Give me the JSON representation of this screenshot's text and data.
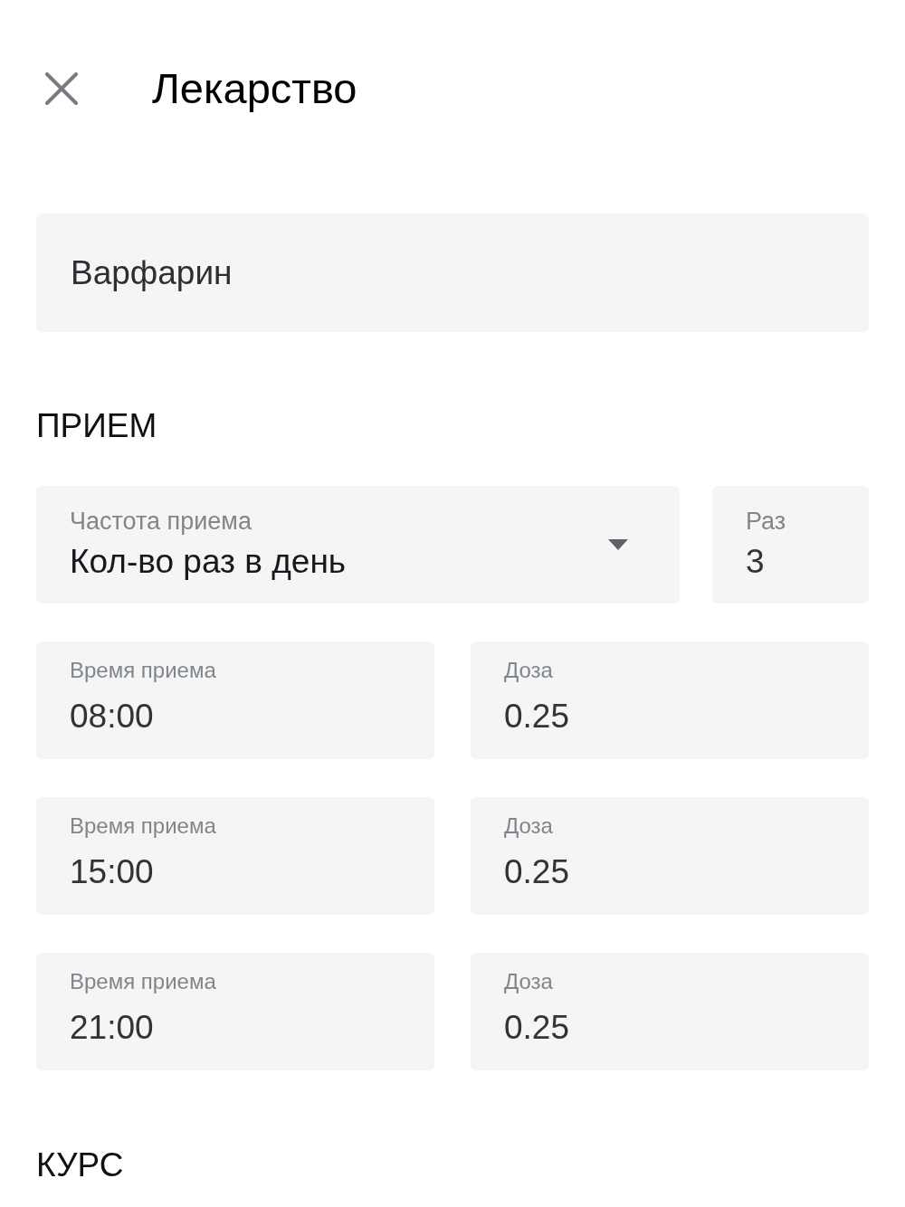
{
  "header": {
    "title": "Лекарство"
  },
  "name_field": {
    "value": "Варфарин"
  },
  "intake": {
    "heading": "ПРИЕМ",
    "frequency": {
      "label": "Частота приема",
      "value": "Кол-во раз в день"
    },
    "times_count": {
      "label": "Раз",
      "value": "3"
    },
    "doses": [
      {
        "time_label": "Время приема",
        "time": "08:00",
        "dose_label": "Доза",
        "dose": "0.25"
      },
      {
        "time_label": "Время приема",
        "time": "15:00",
        "dose_label": "Доза",
        "dose": "0.25"
      },
      {
        "time_label": "Время приема",
        "time": "21:00",
        "dose_label": "Доза",
        "dose": "0.25"
      }
    ]
  },
  "course": {
    "heading": "КУРС"
  }
}
